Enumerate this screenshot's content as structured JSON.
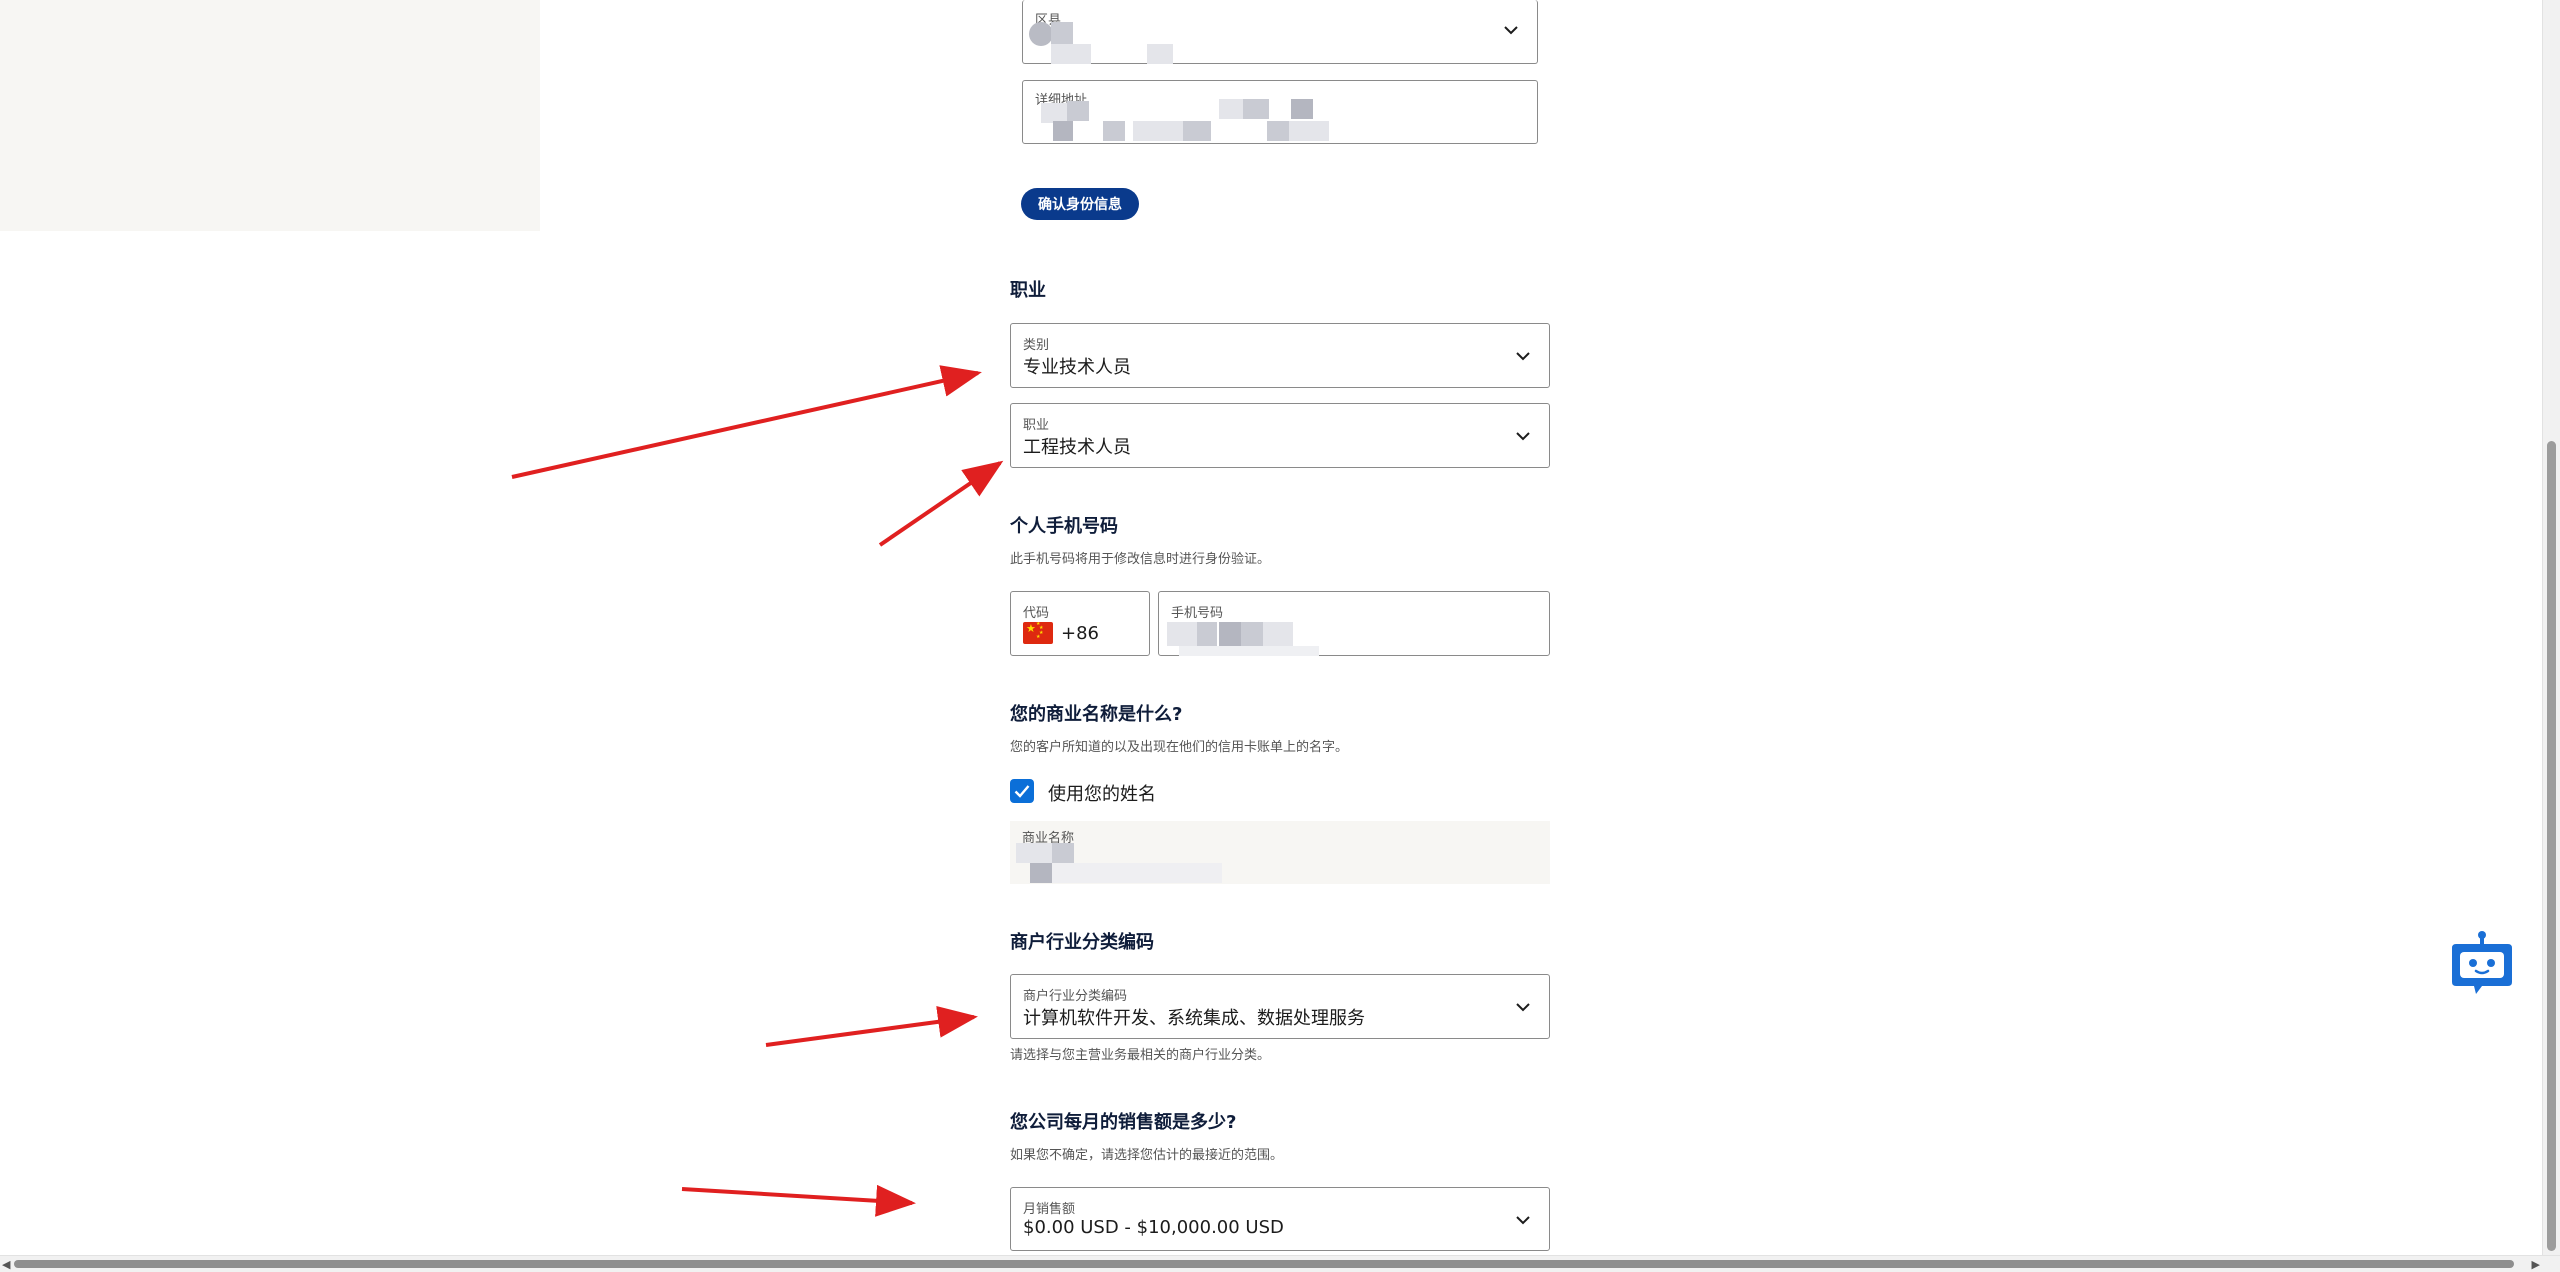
{
  "identity": {
    "district": {
      "label": "区县"
    },
    "address": {
      "label": "详细地址"
    },
    "confirm_button": "确认身份信息"
  },
  "occupation": {
    "heading": "职业",
    "category": {
      "label": "类别",
      "value": "专业技术人员"
    },
    "job": {
      "label": "职业",
      "value": "工程技术人员"
    }
  },
  "phone": {
    "heading": "个人手机号码",
    "help": "此手机号码将用于修改信息时进行身份验证。",
    "code": {
      "label": "代码",
      "value": "+86",
      "flag_icon": "china-flag-icon"
    },
    "number": {
      "label": "手机号码"
    }
  },
  "business_name": {
    "heading": "您的商业名称是什么?",
    "help": "您的客户所知道的以及出现在他们的信用卡账单上的名字。",
    "use_name_checkbox": {
      "label": "使用您的姓名",
      "checked": true
    },
    "name_field": {
      "label": "商业名称"
    }
  },
  "industry": {
    "heading": "商户行业分类编码",
    "select": {
      "label": "商户行业分类编码",
      "value": "计算机软件开发、系统集成、数据处理服务"
    },
    "help": "请选择与您主营业务最相关的商户行业分类。"
  },
  "sales": {
    "heading": "您公司每月的销售额是多少?",
    "help": "如果您不确定，请选择您估计的最接近的范围。",
    "select": {
      "label": "月销售额",
      "value": "$0.00 USD - $10,000.00 USD"
    }
  },
  "colors": {
    "primary_button": "#0a3a8c",
    "checkbox": "#0b6fd8",
    "annotation_arrow": "#e02020",
    "chatbot": "#1a6fd6"
  },
  "icons": [
    "chevron-down-icon",
    "check-icon",
    "chatbot-icon",
    "china-flag-icon"
  ]
}
